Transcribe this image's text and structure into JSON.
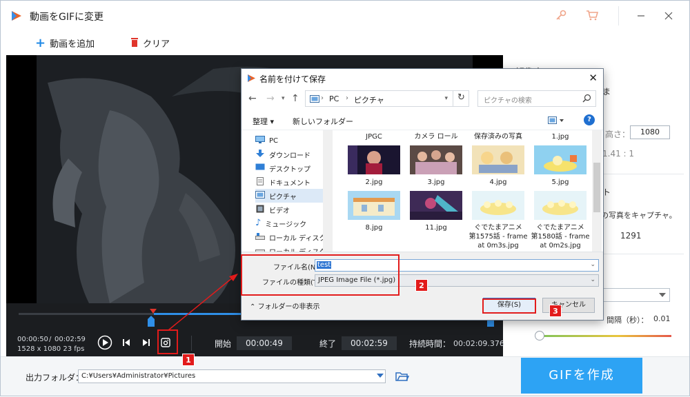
{
  "app": {
    "title": "動画をGIFに変更"
  },
  "toolbar": {
    "add_video": "動画を追加",
    "clear": "クリア"
  },
  "controls": {
    "current_time": "00:00:50",
    "separator": "/",
    "total_time": "00:02:59",
    "resolution_fps": "1528 x 1080   23 fps",
    "start_label": "開始",
    "start_time": "00:00:49",
    "end_label": "終了",
    "end_time": "00:02:59",
    "duration_label": "持続時間：",
    "duration_value": "00:02:09.376"
  },
  "right_panel": {
    "heading_partial": "解像度",
    "line2_partial": "ま",
    "height_label": "高さ：",
    "height_value": "1080",
    "ratio": "1.41 : 1",
    "section2_partial": "ト",
    "capture_text": "の写真をキャプチャ。",
    "count_value": "1291",
    "interval_label": "間隔（秒）：",
    "interval_value": "0.01"
  },
  "bottom": {
    "output_label": "出力フォルダ：",
    "output_path": "C:¥Users¥Administrator¥Pictures",
    "create_button": "GIFを作成"
  },
  "dialog": {
    "title": "名前を付けて保存",
    "breadcrumb": [
      "PC",
      "ピクチャ"
    ],
    "search_placeholder": "ピクチャの検索",
    "organize": "整理 ▾",
    "new_folder": "新しいフォルダー",
    "tree": [
      {
        "label": "PC",
        "icon": "pc-icon"
      },
      {
        "label": "ダウンロード",
        "icon": "download-icon"
      },
      {
        "label": "デスクトップ",
        "icon": "desktop-icon"
      },
      {
        "label": "ドキュメント",
        "icon": "document-icon"
      },
      {
        "label": "ピクチャ",
        "icon": "pictures-icon"
      },
      {
        "label": "ビデオ",
        "icon": "video-icon"
      },
      {
        "label": "ミュージック",
        "icon": "music-icon"
      },
      {
        "label": "ローカル ディスク (C",
        "icon": "disk-icon"
      },
      {
        "label": "ローカル ディスク (D",
        "icon": "disk-icon"
      }
    ],
    "files_row0": [
      "JPGC",
      "カメラ ロール",
      "保存済みの写真",
      "1.jpg"
    ],
    "files_row1": [
      "2.jpg",
      "3.jpg",
      "4.jpg",
      "5.jpg"
    ],
    "files_row2": [
      "8.jpg",
      "11.jpg",
      "ぐでたまアニメ　第1575話 - frame at 0m3s.jpg",
      "ぐでたまアニメ　第1580話 - frame at 0m2s.jpg"
    ],
    "filename_label": "ファイル名(N):",
    "filename_value": "test",
    "filetype_label": "ファイルの種類(T):",
    "filetype_value": "JPEG Image File (*.jpg)",
    "hide_folders": "フォルダーの非表示",
    "save_button": "保存(S)",
    "cancel_button": "キャンセル"
  },
  "annotations": {
    "badges": [
      "1",
      "2",
      "3"
    ],
    "color": "#e21b1b"
  },
  "colors": {
    "accent": "#2da3f4",
    "selection": "#2f76d2"
  }
}
